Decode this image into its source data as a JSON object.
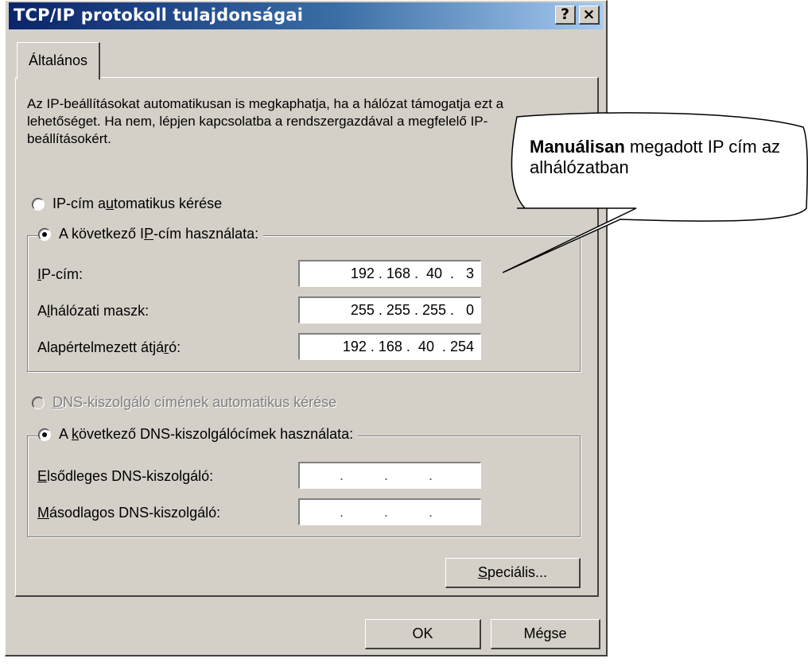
{
  "window": {
    "title": "TCP/IP protokoll tulajdonságai",
    "help_label": "?",
    "close_label": "×"
  },
  "tabs": [
    {
      "label": "Általános"
    }
  ],
  "description": "Az IP-beállításokat automatikusan is megkaphatja, ha a hálózat támogatja ezt a lehetőséget. Ha nem, lépjen kapcsolatba a rendszergazdával a megfelelő IP-beállításokért.",
  "ip": {
    "auto_radio": {
      "pre": "IP-cím a",
      "accel": "u",
      "post": "tomatikus kérése"
    },
    "manual_radio": {
      "pre": "A következő I",
      "accel": "P",
      "post": "-cím használata:"
    },
    "fields": [
      {
        "pre": "",
        "accel": "I",
        "post": "P-cím:",
        "value": "192 . 168 .  40  .   3"
      },
      {
        "pre": "A",
        "accel": "l",
        "post": "hálózati maszk:",
        "value": "255 . 255 . 255 .   0"
      },
      {
        "pre": "Alapértelmezett átjá",
        "accel": "r",
        "post": "ó:",
        "value": "192 . 168 .  40  . 254"
      }
    ]
  },
  "dns": {
    "auto_radio": {
      "pre": "",
      "accel": "D",
      "post": "NS-kiszolgáló címének automatikus kérése"
    },
    "manual_radio": {
      "pre": "A ",
      "accel": "k",
      "post": "övetkező DNS-kiszolgálócímek használata:"
    },
    "fields": [
      {
        "pre": "",
        "accel": "E",
        "post": "lsődleges DNS-kiszolgáló:",
        "value": ".       .       ."
      },
      {
        "pre": "",
        "accel": "M",
        "post": "ásodlagos DNS-kiszolgáló:",
        "value": ".       .       ."
      }
    ]
  },
  "advanced_button": {
    "accel": "S",
    "post": "peciális..."
  },
  "ok_label": "OK",
  "cancel_label": "Mégse",
  "callout": {
    "bold": "Manuálisan",
    "text": " megadott IP cím az alhálózatban"
  }
}
